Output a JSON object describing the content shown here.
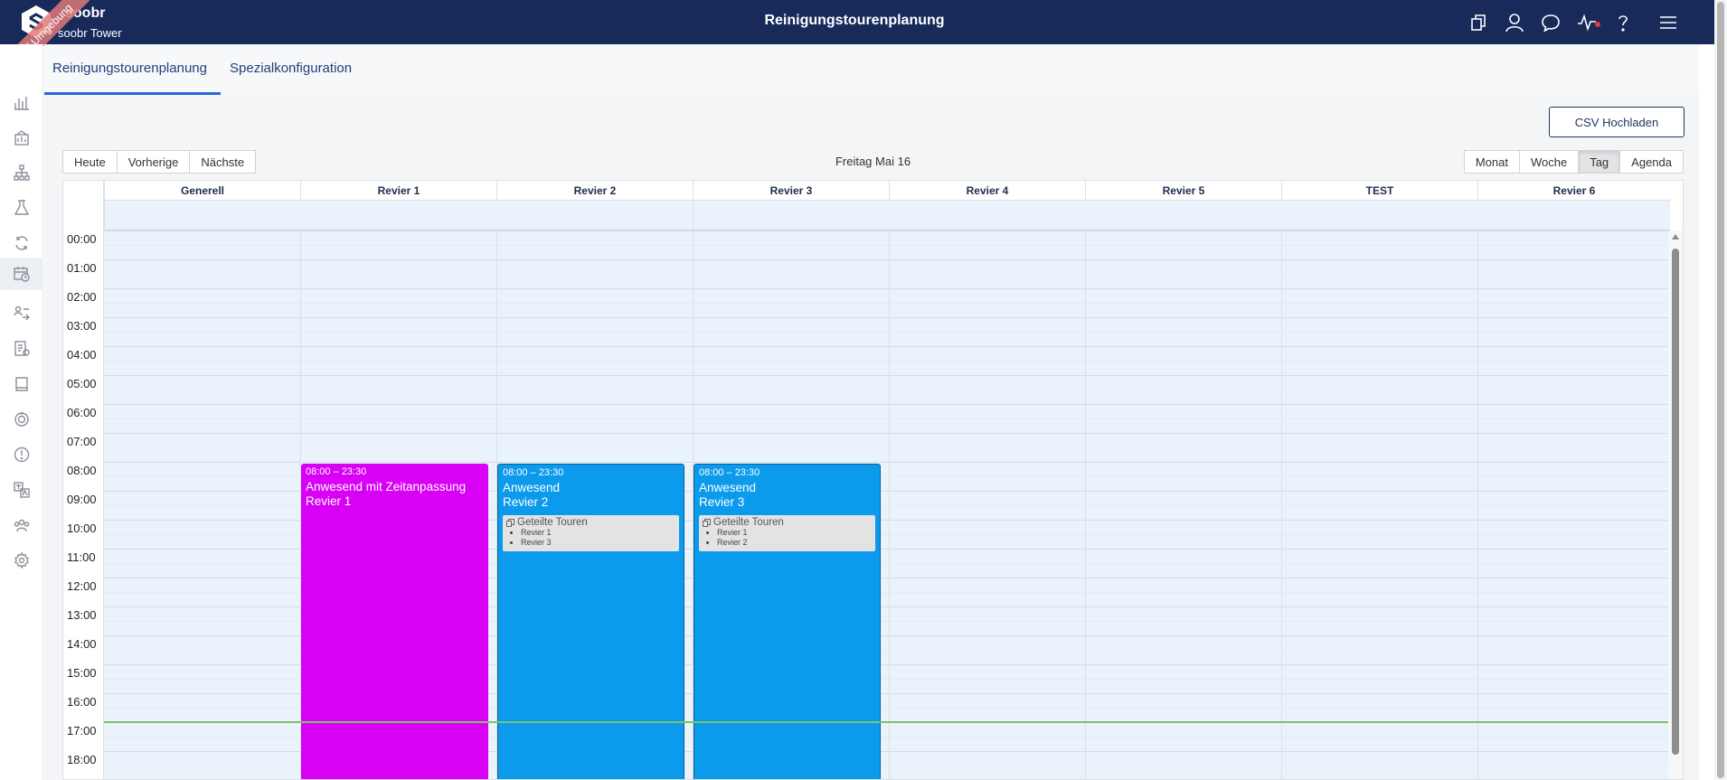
{
  "header": {
    "brand_name": "soobr",
    "site_name": "soobr Tower",
    "environment_ribbon": "TEST Umgebung",
    "title": "Reinigungstourenplanung",
    "icons": [
      "copy-icon",
      "user-icon",
      "chat-icon",
      "activity-icon",
      "help-icon",
      "menu-icon"
    ],
    "accent_color": "#172a5a"
  },
  "sidebar": {
    "icons": [
      "bar-chart-icon",
      "building-chart-icon",
      "org-chart-icon",
      "lab-flask-icon",
      "refresh-cycle-icon",
      "calendar-clock-icon",
      "people-swap-icon",
      "checklist-icon",
      "book-icon",
      "target-icon",
      "alert-icon",
      "translate-icon",
      "group-icon",
      "settings-icon"
    ],
    "active": "calendar-clock-icon"
  },
  "tabs": [
    {
      "label": "Reinigungstourenplanung",
      "active": true
    },
    {
      "label": "Spezialkonfiguration",
      "active": false
    }
  ],
  "actions": {
    "csv_upload": "CSV Hochladen"
  },
  "calendar": {
    "nav": {
      "today": "Heute",
      "previous": "Vorherige",
      "next": "Nächste"
    },
    "date_label": "Freitag Mai 16",
    "views": [
      {
        "label": "Monat",
        "active": false
      },
      {
        "label": "Woche",
        "active": false
      },
      {
        "label": "Tag",
        "active": true
      },
      {
        "label": "Agenda",
        "active": false
      }
    ],
    "resources": [
      "Generell",
      "Revier 1",
      "Revier 2",
      "Revier 3",
      "Revier 4",
      "Revier 5",
      "TEST",
      "Revier 6"
    ],
    "hours": [
      "00:00",
      "01:00",
      "02:00",
      "03:00",
      "04:00",
      "05:00",
      "06:00",
      "07:00",
      "08:00",
      "09:00",
      "10:00",
      "11:00",
      "12:00",
      "13:00",
      "14:00",
      "15:00",
      "16:00",
      "17:00",
      "18:00"
    ],
    "events": [
      {
        "resource": "Revier 1",
        "time": "08:00 – 23:30",
        "title_line1": "Anwesend mit Zeitanpassung",
        "title_line2": "Revier 1",
        "color": "#d800f5"
      },
      {
        "resource": "Revier 2",
        "time": "08:00 – 23:30",
        "title_line1": "Anwesend",
        "title_line2": "Revier 2",
        "color": "#0b9aec",
        "shared": {
          "title": "Geteilte Touren",
          "items": [
            "Revier 1",
            "Revier 3"
          ]
        }
      },
      {
        "resource": "Revier 3",
        "time": "08:00 – 23:30",
        "title_line1": "Anwesend",
        "title_line2": "Revier 3",
        "color": "#0b9aec",
        "shared": {
          "title": "Geteilte Touren",
          "items": [
            "Revier 1",
            "Revier 2"
          ]
        }
      }
    ],
    "now_indicator_color": "#7bc36a"
  }
}
